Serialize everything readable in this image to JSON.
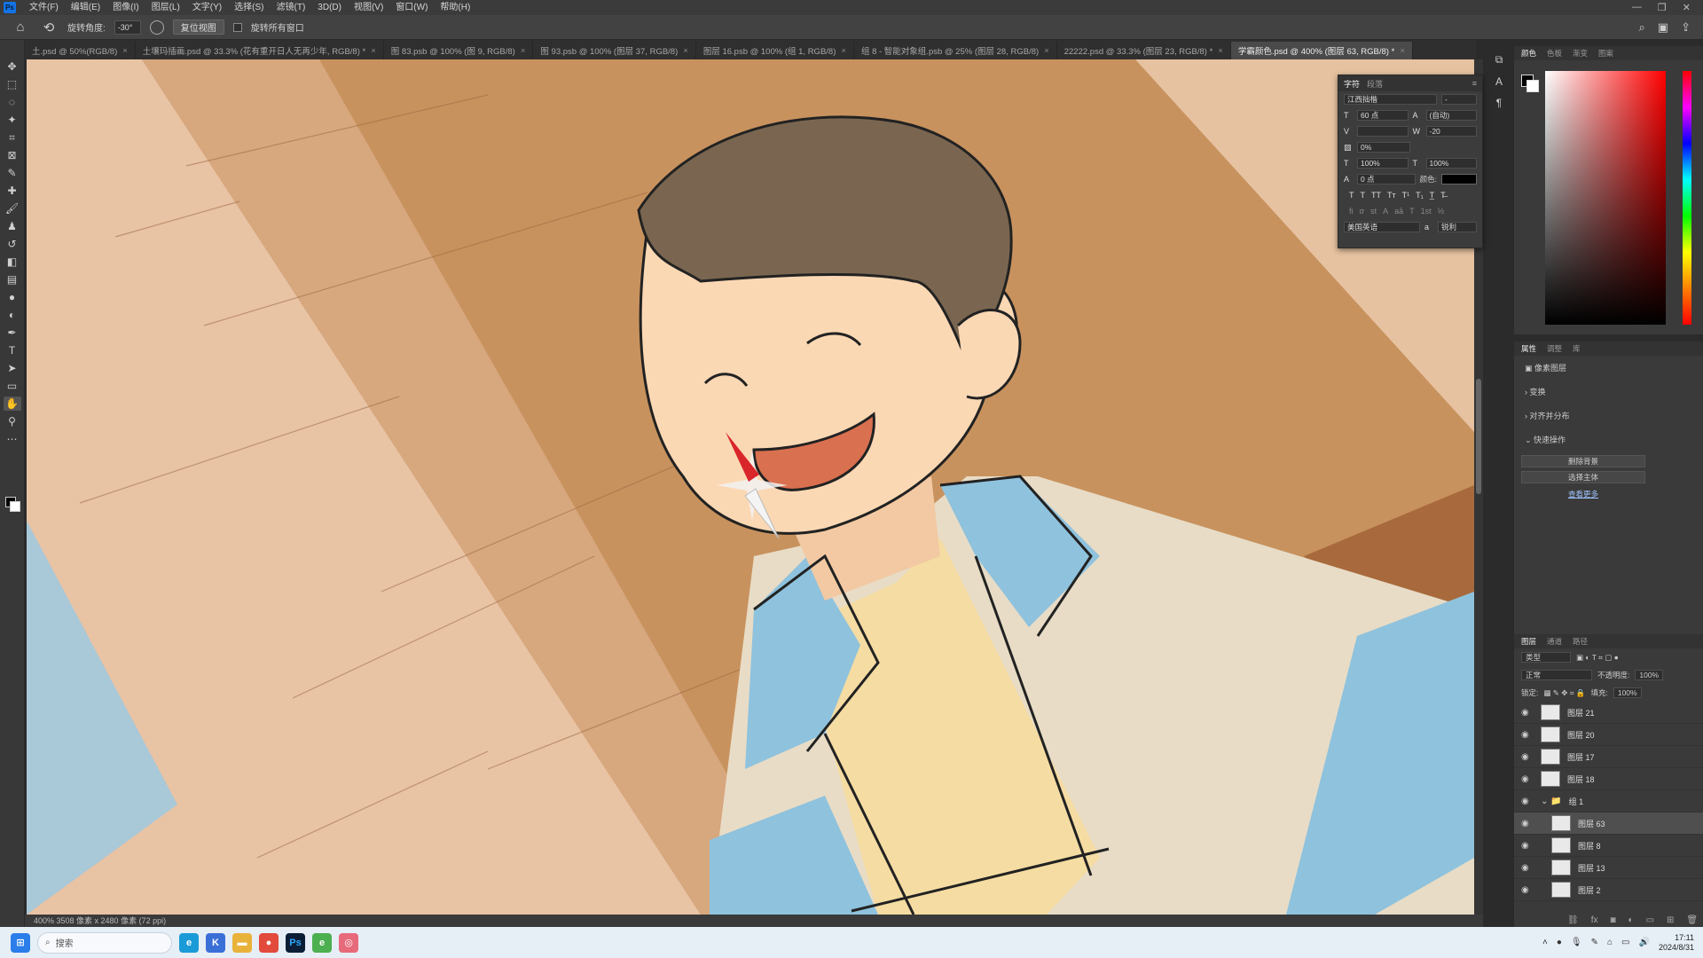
{
  "menu": [
    "文件(F)",
    "编辑(E)",
    "图像(I)",
    "图层(L)",
    "文字(Y)",
    "选择(S)",
    "滤镜(T)",
    "3D(D)",
    "视图(V)",
    "窗口(W)",
    "帮助(H)"
  ],
  "options": {
    "rotate_label": "旋转角度:",
    "rotate_value": "-30°",
    "reset_view": "复位视图",
    "rotate_all": "旋转所有窗口"
  },
  "tabs": [
    {
      "label": "土.psd @ 50%(RGB/8)"
    },
    {
      "label": "土壤玛插画.psd @ 33.3% (花有重开日人无再少年, RGB/8) *"
    },
    {
      "label": "图 83.psb @ 100% (图 9, RGB/8)"
    },
    {
      "label": "图 93.psb @ 100% (图层 37, RGB/8)"
    },
    {
      "label": "图层 16.psb @ 100% (组 1, RGB/8)"
    },
    {
      "label": "组 8 - 智能对象组.psb @ 25% (图层 28, RGB/8)"
    },
    {
      "label": "22222.psd @ 33.3% (图层 23, RGB/8) *"
    },
    {
      "label": "学霸颜色.psd @ 400% (图层 63, RGB/8) *"
    }
  ],
  "status": "400%    3508 像素 x 2480 像素 (72 ppi)",
  "character": {
    "tab1": "字符",
    "tab2": "段落",
    "font": "江西拙楷",
    "size": "60 点",
    "leading": "(自动)",
    "tracking": "-20",
    "scale_pct": "0%",
    "v_scale": "100%",
    "h_scale": "100%",
    "baseline": "0 点",
    "color_label": "颜色:",
    "language": "美国英语",
    "aa": "锐利"
  },
  "color_panel": {
    "tabs": [
      "颜色",
      "色板",
      "渐变",
      "图案"
    ]
  },
  "properties": {
    "tabs": [
      "属性",
      "调整",
      "库"
    ],
    "type": "像素图层",
    "sections": [
      "变换",
      "对齐并分布",
      "快速操作"
    ],
    "btn1": "删除背景",
    "btn2": "选择主体",
    "link": "查看更多"
  },
  "layers": {
    "tabs": [
      "图层",
      "通道",
      "路径"
    ],
    "filter": "类型",
    "blend": "正常",
    "opacity_label": "不透明度:",
    "opacity": "100%",
    "lock_label": "锁定:",
    "fill_label": "填充:",
    "fill": "100%",
    "items": [
      {
        "name": "图层 21"
      },
      {
        "name": "图层 20"
      },
      {
        "name": "图层 17"
      },
      {
        "name": "图层 18"
      },
      {
        "name": "组 1"
      },
      {
        "name": "图层 63"
      },
      {
        "name": "图层 8"
      },
      {
        "name": "图层 13"
      },
      {
        "name": "图层 2"
      }
    ]
  },
  "taskbar": {
    "search_placeholder": "搜索",
    "time": "17:11",
    "date": "2024/8/31"
  }
}
